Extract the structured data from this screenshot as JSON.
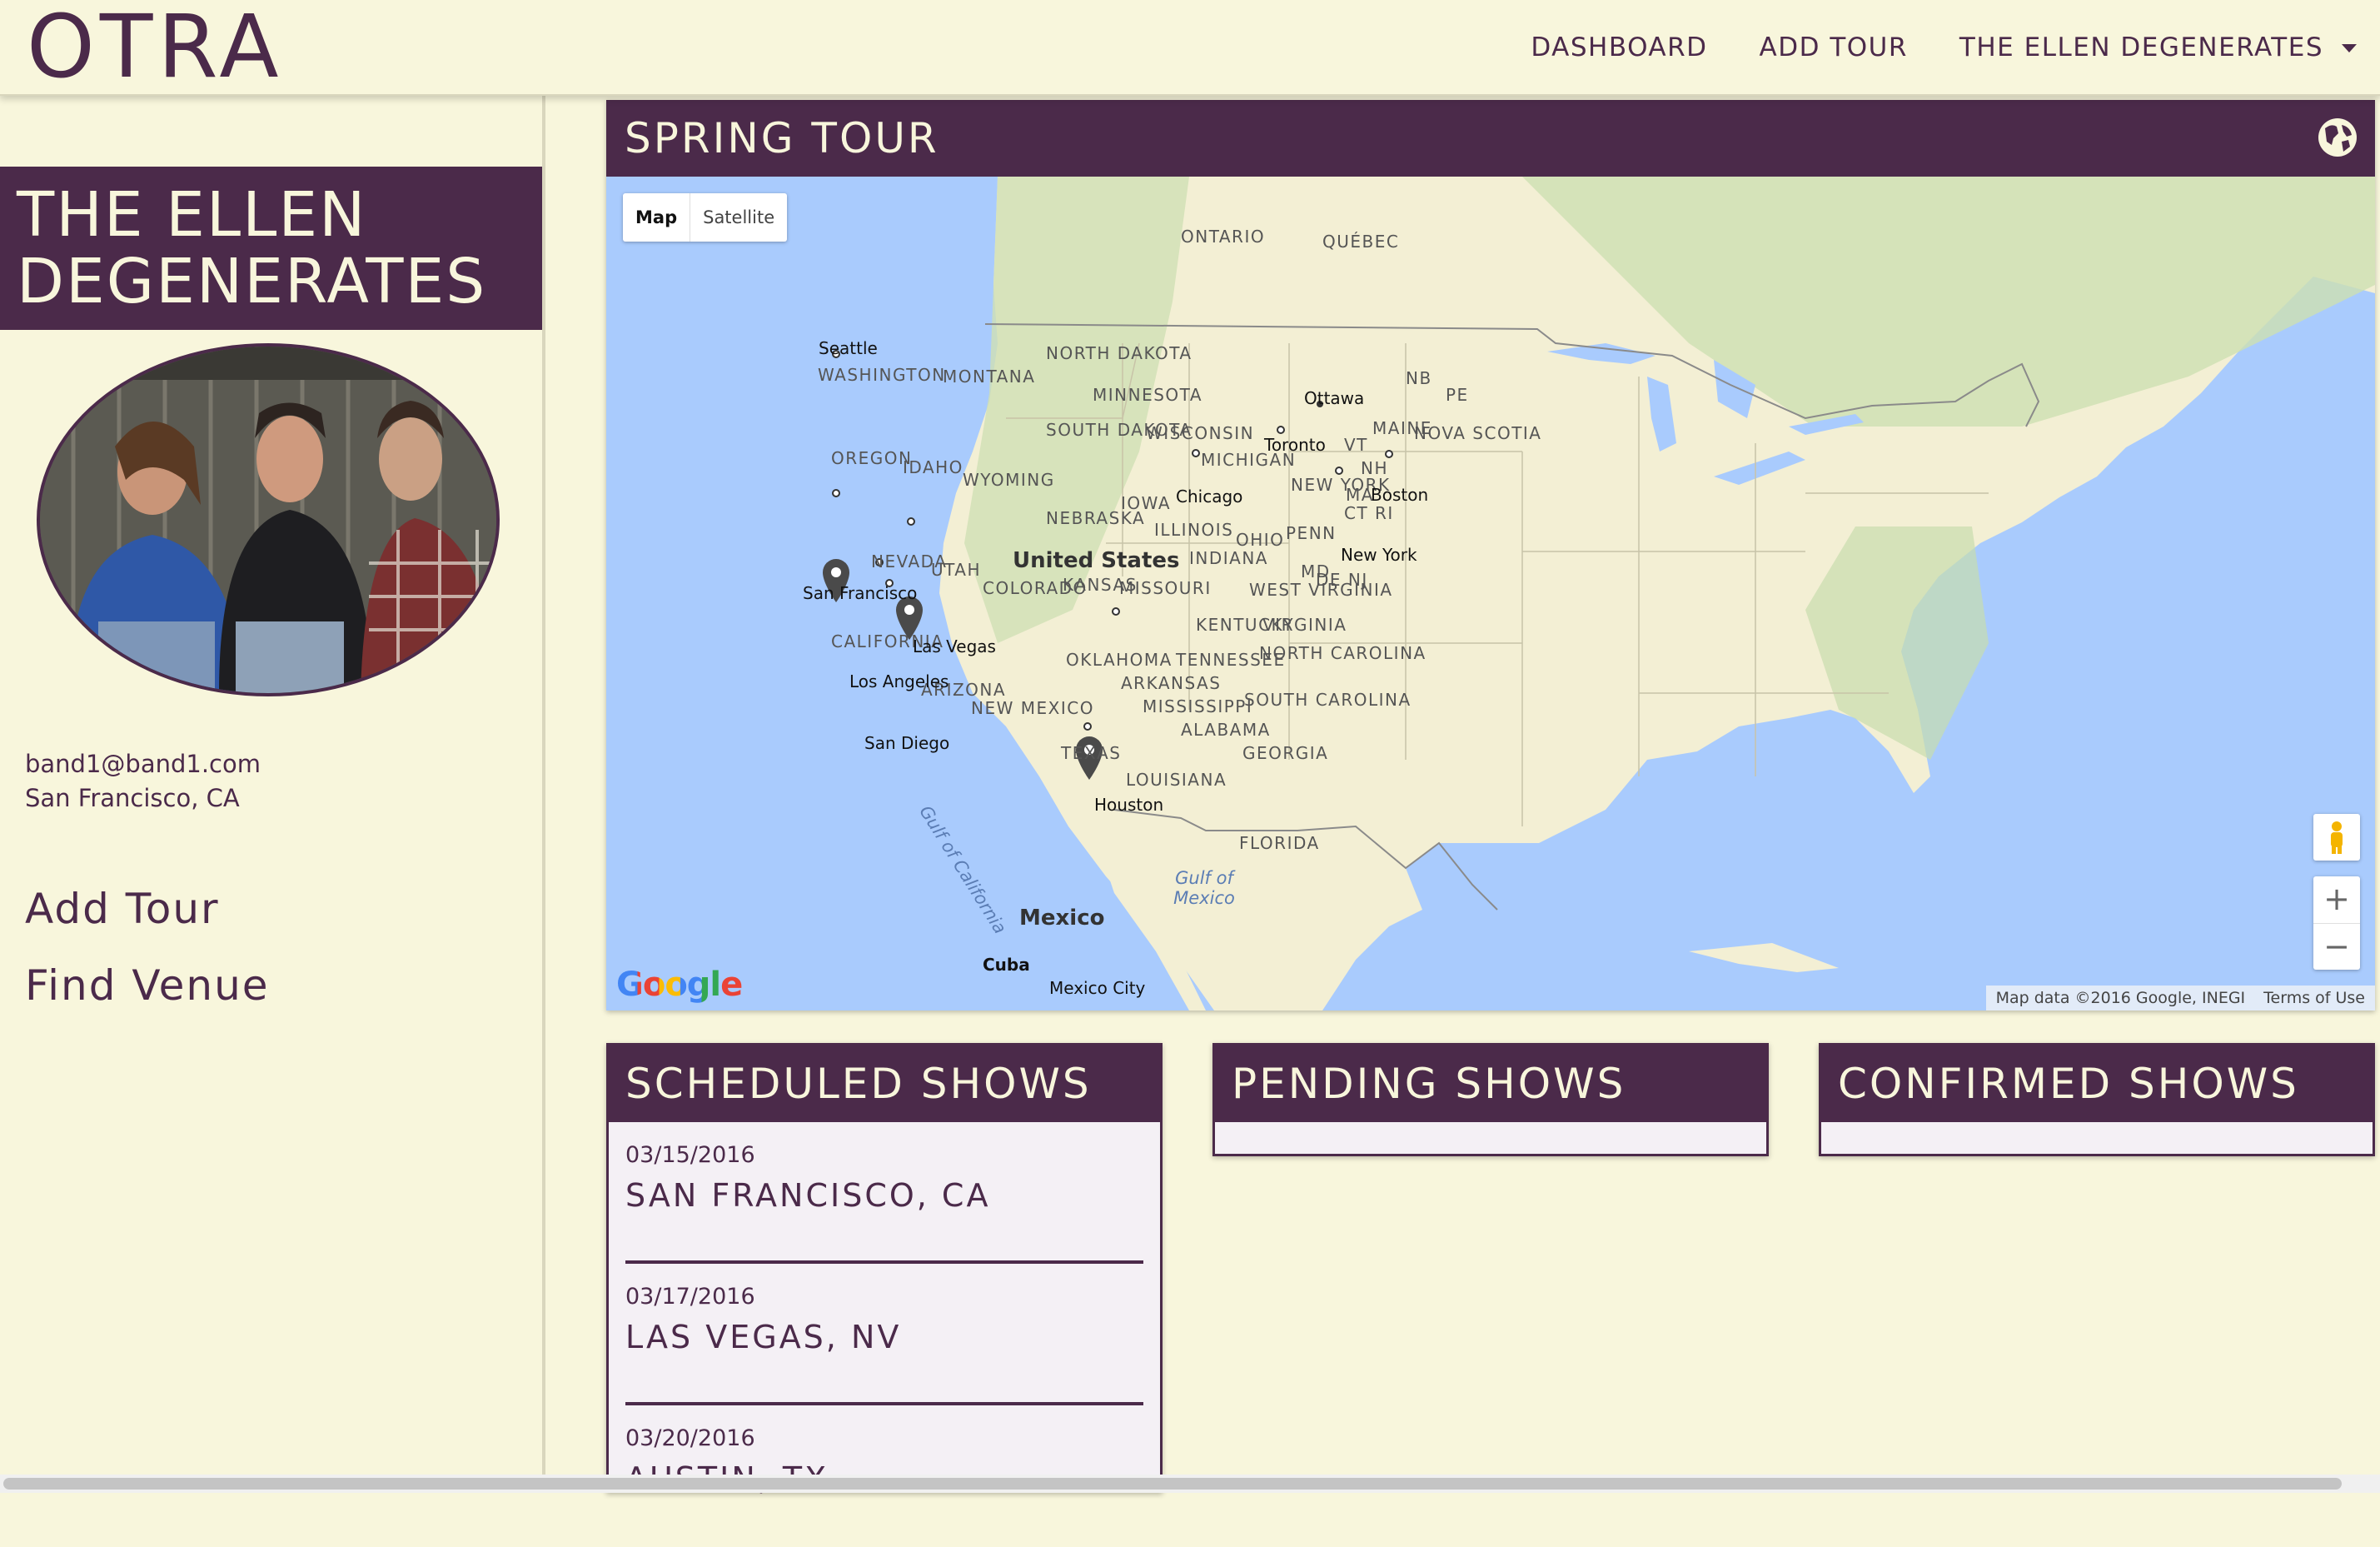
{
  "app": {
    "logo": "OTRA"
  },
  "nav": {
    "items": [
      "DASHBOARD",
      "ADD TOUR",
      "THE ELLEN DEGENERATES"
    ]
  },
  "band": {
    "name": "THE ELLEN\nDEGENERATES",
    "email": "band1@band1.com",
    "location": "San Francisco, CA",
    "links": [
      "Add Tour",
      "Find Venue"
    ]
  },
  "tour": {
    "title": "SPRING TOUR",
    "map": {
      "type_buttons": [
        "Map",
        "Satellite"
      ],
      "selected_type": "Map",
      "attribution": "Map data ©2016 Google, INEGI",
      "terms": "Terms of Use",
      "google_logo": "Google",
      "zoom_in": "+",
      "zoom_out": "−",
      "markers": [
        "San Francisco",
        "Las Vegas",
        "Austin"
      ],
      "labels": {
        "countries": [
          "United States",
          "Mexico",
          "Cuba"
        ],
        "provinces": [
          "ONTARIO",
          "QUÉBEC",
          "NB",
          "PE",
          "NOVA SCOTIA"
        ],
        "states": [
          "WASHINGTON",
          "OREGON",
          "IDAHO",
          "MONTANA",
          "WYOMING",
          "NORTH DAKOTA",
          "SOUTH DAKOTA",
          "NEBRASKA",
          "MINNESOTA",
          "IOWA",
          "WISCONSIN",
          "MICHIGAN",
          "ILLINOIS",
          "INDIANA",
          "OHIO",
          "PENN",
          "NEW YORK",
          "VT",
          "NH",
          "MAINE",
          "MA",
          "CT RI",
          "MD",
          "DE NJ",
          "NEVADA",
          "UTAH",
          "COLORADO",
          "KANSAS",
          "MISSOURI",
          "KENTUCKY",
          "WEST VIRGINIA",
          "VIRGINIA",
          "CALIFORNIA",
          "ARIZONA",
          "NEW MEXICO",
          "OKLAHOMA",
          "ARKANSAS",
          "TENNESSEE",
          "NORTH CAROLINA",
          "SOUTH CAROLINA",
          "MISSISSIPPI",
          "ALABAMA",
          "GEORGIA",
          "TEXAS",
          "LOUISIANA",
          "FLORIDA"
        ],
        "cities": [
          "Seattle",
          "San Francisco",
          "Las Vegas",
          "Los Angeles",
          "San Diego",
          "Houston",
          "Chicago",
          "Toronto",
          "Ottawa",
          "Boston",
          "New York",
          "Mexico City"
        ],
        "water": [
          "Gulf of Mexico",
          "Gulf of California"
        ]
      }
    }
  },
  "panels": {
    "scheduled": {
      "title": "SCHEDULED SHOWS",
      "shows": [
        {
          "date": "03/15/2016",
          "city": "SAN FRANCISCO, CA"
        },
        {
          "date": "03/17/2016",
          "city": "LAS VEGAS, NV"
        },
        {
          "date": "03/20/2016",
          "city": "AUSTIN, TX"
        }
      ]
    },
    "pending": {
      "title": "PENDING SHOWS",
      "shows": []
    },
    "confirmed": {
      "title": "CONFIRMED SHOWS",
      "shows": []
    }
  },
  "colors": {
    "brand_plum": "#4b2a4a",
    "background_cream": "#f8f6dc",
    "panel_body": "#f4f0f5",
    "map_water": "#a9cbfd",
    "map_land": "#f3efd4"
  },
  "icons": [
    "globe-icon",
    "chevron-down-icon",
    "map-marker-icon",
    "pegman-icon"
  ]
}
